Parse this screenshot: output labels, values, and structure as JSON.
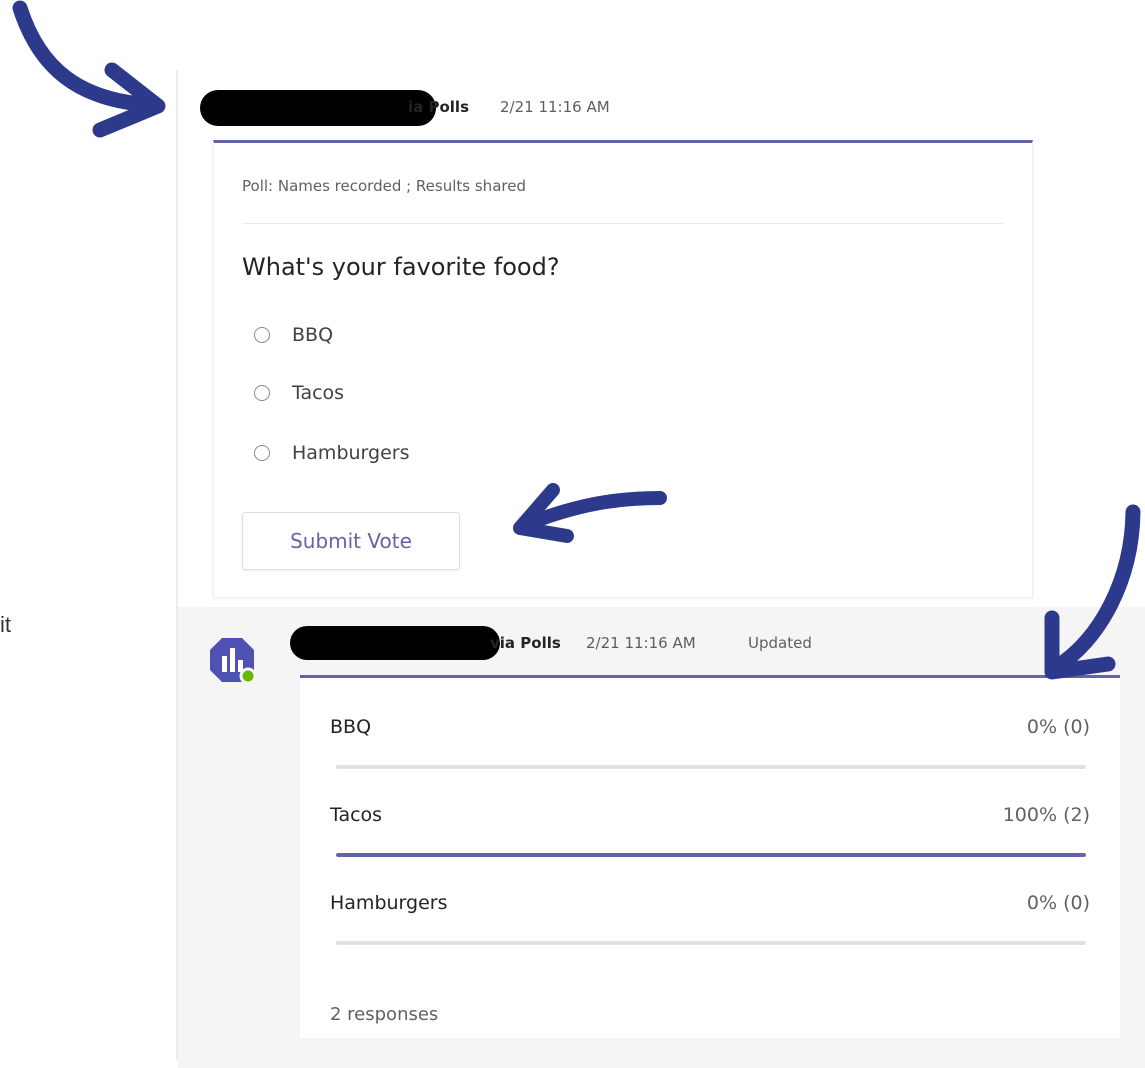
{
  "clipped_side_text": "it",
  "message1": {
    "sender_suffix": "ia Polls",
    "timestamp": "2/21 11:16 AM",
    "poll_meta": "Poll: Names recorded ; Results shared",
    "question": "What's your favorite food?",
    "options": [
      "BBQ",
      "Tacos",
      "Hamburgers"
    ],
    "submit_label": "Submit Vote"
  },
  "message2": {
    "sender_suffix": "via Polls",
    "timestamp": "2/21 11:16 AM",
    "status": "Updated",
    "results": [
      {
        "label": "BBQ",
        "value": "0% (0)",
        "fraction": 0
      },
      {
        "label": "Tacos",
        "value": "100% (2)",
        "fraction": 1
      },
      {
        "label": "Hamburgers",
        "value": "0% (0)",
        "fraction": 0
      }
    ],
    "responses": "2 responses"
  },
  "colors": {
    "accent": "#6264a7",
    "annotation_arrow": "#2d3a8c",
    "presence_green": "#6bb700"
  },
  "icons": {
    "avatar": "polls-app-icon",
    "presence": "presence-available-icon"
  }
}
